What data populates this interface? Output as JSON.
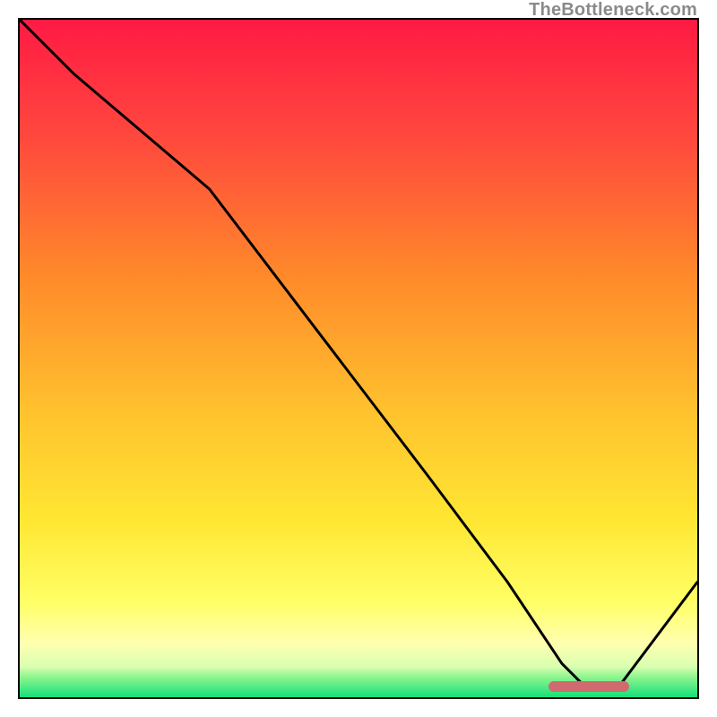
{
  "watermark": "TheBottleneck.com",
  "colors": {
    "red": "#ff1a44",
    "orange": "#ff8a2a",
    "yellow": "#ffe733",
    "pale_yellow": "#ffff9e",
    "green_top": "#7ef27e",
    "green_bottom": "#14e07a",
    "curve": "#000000",
    "marker": "#cf6b6e",
    "border": "#000000"
  },
  "chart_data": {
    "type": "line",
    "title": "",
    "xlabel": "",
    "ylabel": "",
    "xlim": [
      0,
      100
    ],
    "ylim": [
      0,
      100
    ],
    "x": [
      0,
      8,
      28,
      44,
      60,
      72,
      80,
      84,
      88,
      100
    ],
    "values": [
      100,
      92,
      75,
      54,
      33,
      17,
      5,
      1,
      1,
      17
    ],
    "optimal_range_x": [
      78,
      90
    ],
    "annotations": [
      "TheBottleneck.com"
    ]
  }
}
